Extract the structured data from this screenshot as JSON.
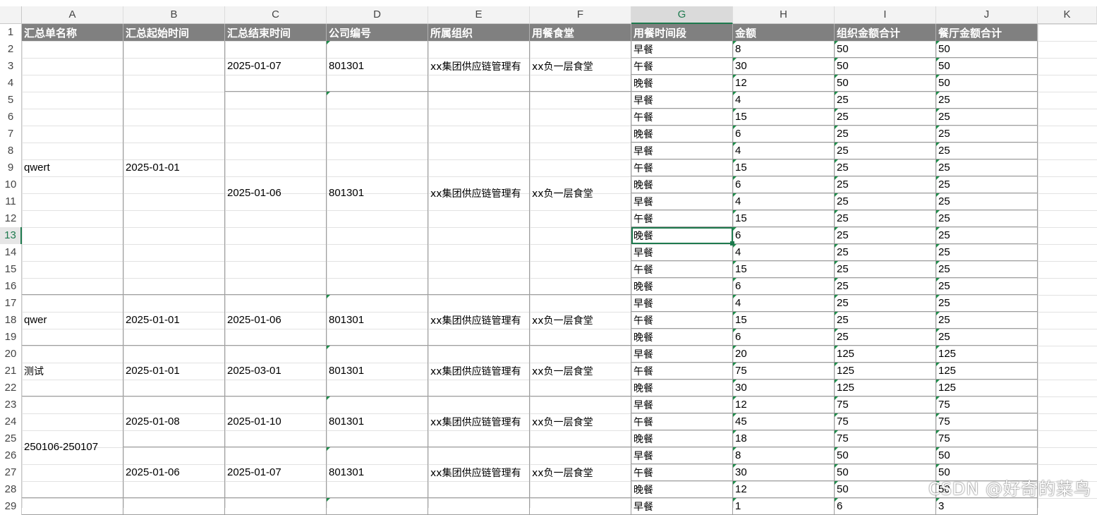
{
  "columns": [
    "A",
    "B",
    "C",
    "D",
    "E",
    "F",
    "G",
    "H",
    "I",
    "J",
    "K"
  ],
  "active_column": "G",
  "active_row": 13,
  "header": [
    "汇总单名称",
    "汇总起始时间",
    "汇总结束时间",
    "公司编号",
    "所属组织",
    "用餐食堂",
    "用餐时间段",
    "金额",
    "组织金额合计",
    "餐厅金额合计"
  ],
  "rows": [
    {
      "g": "早餐",
      "h": "8",
      "i": "50",
      "j": "50"
    },
    {
      "g": "午餐",
      "h": "30",
      "i": "50",
      "j": "50"
    },
    {
      "g": "晚餐",
      "h": "12",
      "i": "50",
      "j": "50"
    },
    {
      "g": "早餐",
      "h": "4",
      "i": "25",
      "j": "25"
    },
    {
      "g": "午餐",
      "h": "15",
      "i": "25",
      "j": "25"
    },
    {
      "g": "晚餐",
      "h": "6",
      "i": "25",
      "j": "25"
    },
    {
      "g": "早餐",
      "h": "4",
      "i": "25",
      "j": "25"
    },
    {
      "g": "午餐",
      "h": "15",
      "i": "25",
      "j": "25"
    },
    {
      "g": "晚餐",
      "h": "6",
      "i": "25",
      "j": "25"
    },
    {
      "g": "早餐",
      "h": "4",
      "i": "25",
      "j": "25"
    },
    {
      "g": "午餐",
      "h": "15",
      "i": "25",
      "j": "25"
    },
    {
      "g": "晚餐",
      "h": "6",
      "i": "25",
      "j": "25"
    },
    {
      "g": "早餐",
      "h": "4",
      "i": "25",
      "j": "25"
    },
    {
      "g": "午餐",
      "h": "15",
      "i": "25",
      "j": "25"
    },
    {
      "g": "晚餐",
      "h": "6",
      "i": "25",
      "j": "25"
    },
    {
      "g": "早餐",
      "h": "4",
      "i": "25",
      "j": "25"
    },
    {
      "g": "午餐",
      "h": "15",
      "i": "25",
      "j": "25"
    },
    {
      "g": "晚餐",
      "h": "6",
      "i": "25",
      "j": "25"
    },
    {
      "g": "早餐",
      "h": "20",
      "i": "125",
      "j": "125"
    },
    {
      "g": "午餐",
      "h": "75",
      "i": "125",
      "j": "125"
    },
    {
      "g": "晚餐",
      "h": "30",
      "i": "125",
      "j": "125"
    },
    {
      "g": "早餐",
      "h": "12",
      "i": "75",
      "j": "75"
    },
    {
      "g": "午餐",
      "h": "45",
      "i": "75",
      "j": "75"
    },
    {
      "g": "晚餐",
      "h": "18",
      "i": "75",
      "j": "75"
    },
    {
      "g": "早餐",
      "h": "8",
      "i": "50",
      "j": "50"
    },
    {
      "g": "午餐",
      "h": "30",
      "i": "50",
      "j": "50"
    },
    {
      "g": "晚餐",
      "h": "12",
      "i": "50",
      "j": "50"
    },
    {
      "g": "早餐",
      "h": "1",
      "i": "6",
      "j": "3"
    }
  ],
  "merged": {
    "a": [
      {
        "r1": 2,
        "r2": 16,
        "text": "qwert"
      },
      {
        "r1": 17,
        "r2": 19,
        "text": "qwer"
      },
      {
        "r1": 20,
        "r2": 22,
        "text": "测试"
      },
      {
        "r1": 23,
        "r2": 28,
        "text": "250106-250107"
      },
      {
        "r1": 29,
        "r2": 29,
        "text": ""
      }
    ],
    "b": [
      {
        "r1": 2,
        "r2": 16,
        "text": "2025-01-01"
      },
      {
        "r1": 17,
        "r2": 19,
        "text": "2025-01-01"
      },
      {
        "r1": 20,
        "r2": 22,
        "text": "2025-01-01"
      },
      {
        "r1": 23,
        "r2": 25,
        "text": "2025-01-08"
      },
      {
        "r1": 26,
        "r2": 28,
        "text": "2025-01-06"
      },
      {
        "r1": 29,
        "r2": 29,
        "text": ""
      }
    ],
    "cdef": [
      {
        "r1": 2,
        "r2": 4,
        "c": "2025-01-07",
        "d": "801301",
        "e": "xx集团供应链管理有",
        "f": "xx负一层食堂"
      },
      {
        "r1": 5,
        "r2": 16,
        "c": "2025-01-06",
        "d": "801301",
        "e": "xx集团供应链管理有",
        "f": "xx负一层食堂"
      },
      {
        "r1": 17,
        "r2": 19,
        "c": "2025-01-06",
        "d": "801301",
        "e": "xx集团供应链管理有",
        "f": "xx负一层食堂"
      },
      {
        "r1": 20,
        "r2": 22,
        "c": "2025-03-01",
        "d": "801301",
        "e": "xx集团供应链管理有",
        "f": "xx负一层食堂"
      },
      {
        "r1": 23,
        "r2": 25,
        "c": "2025-01-10",
        "d": "801301",
        "e": "xx集团供应链管理有",
        "f": "xx负一层食堂"
      },
      {
        "r1": 26,
        "r2": 28,
        "c": "2025-01-07",
        "d": "801301",
        "e": "xx集团供应链管理有",
        "f": "xx负一层食堂"
      },
      {
        "r1": 29,
        "r2": 29,
        "c": "",
        "d": "",
        "e": "",
        "f": ""
      }
    ]
  },
  "watermark": "CSDN @好奇的菜鸟"
}
